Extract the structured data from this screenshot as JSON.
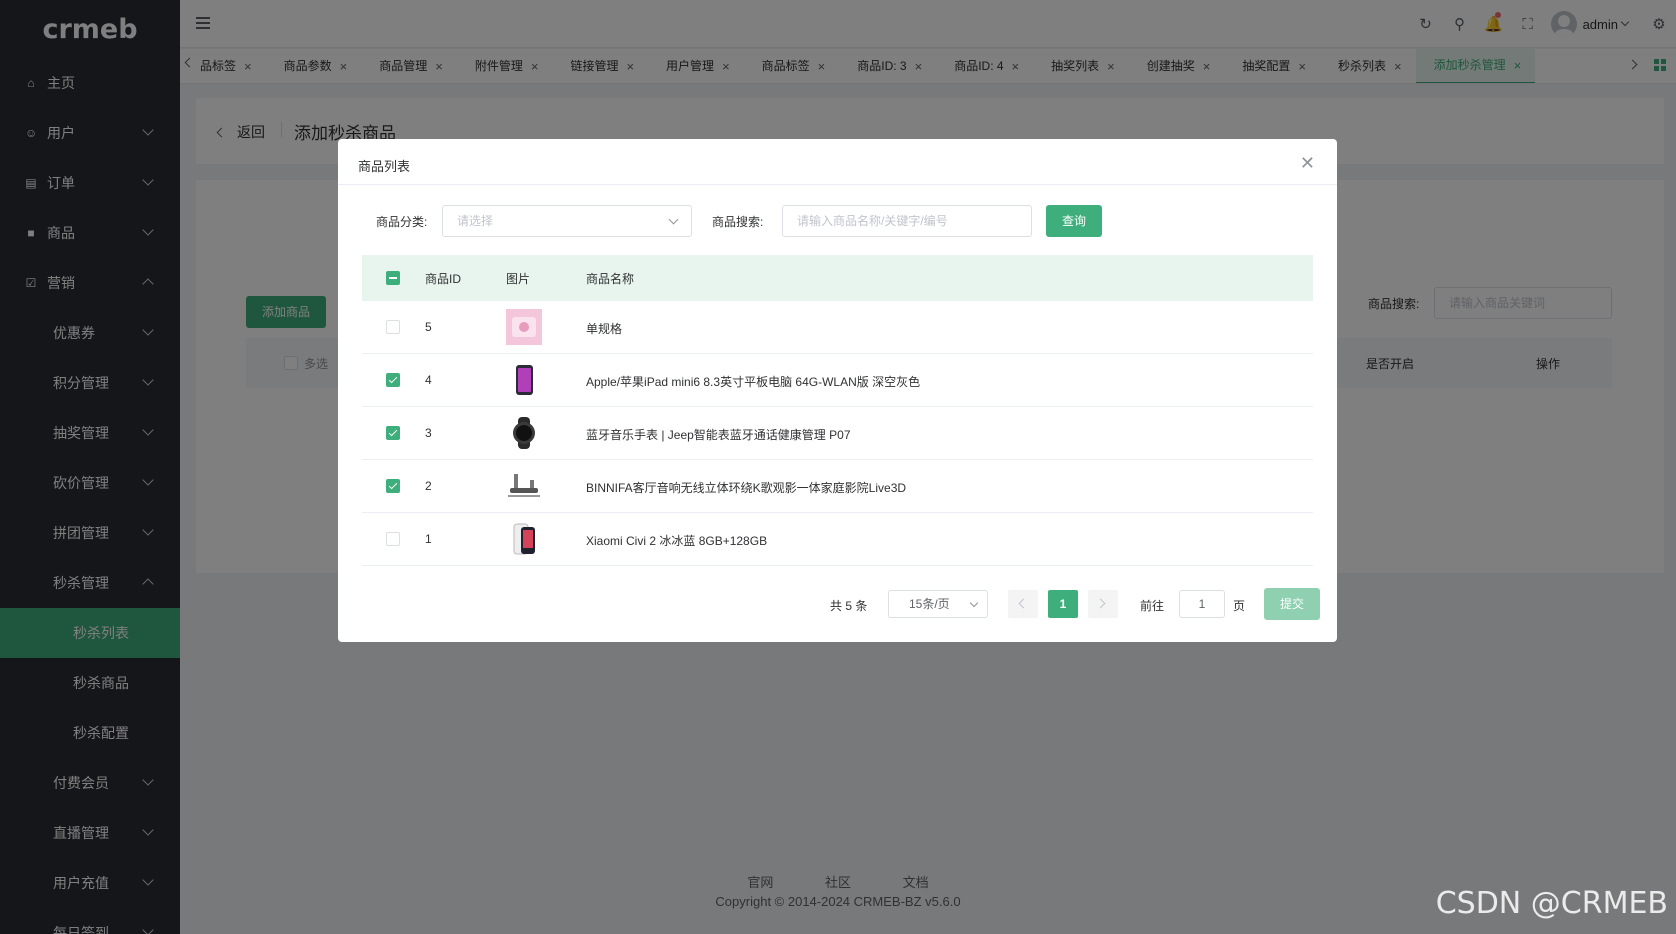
{
  "logo": "crmeb",
  "sidebar": {
    "items": [
      {
        "label": "主页",
        "icon": "home-icon",
        "level": 0,
        "arrow": "none"
      },
      {
        "label": "用户",
        "icon": "user-icon",
        "level": 0,
        "arrow": "down"
      },
      {
        "label": "订单",
        "icon": "order-icon",
        "level": 0,
        "arrow": "down"
      },
      {
        "label": "商品",
        "icon": "product-icon",
        "level": 0,
        "arrow": "down"
      },
      {
        "label": "营销",
        "icon": "marketing-icon",
        "level": 0,
        "arrow": "up"
      },
      {
        "label": "优惠券",
        "level": 1,
        "arrow": "down"
      },
      {
        "label": "积分管理",
        "level": 1,
        "arrow": "down"
      },
      {
        "label": "抽奖管理",
        "level": 1,
        "arrow": "down"
      },
      {
        "label": "砍价管理",
        "level": 1,
        "arrow": "down"
      },
      {
        "label": "拼团管理",
        "level": 1,
        "arrow": "down"
      },
      {
        "label": "秒杀管理",
        "level": 1,
        "arrow": "up"
      },
      {
        "label": "秒杀列表",
        "level": 2,
        "arrow": "none",
        "active": true
      },
      {
        "label": "秒杀商品",
        "level": 2,
        "arrow": "none"
      },
      {
        "label": "秒杀配置",
        "level": 2,
        "arrow": "none"
      },
      {
        "label": "付费会员",
        "level": 1,
        "arrow": "down"
      },
      {
        "label": "直播管理",
        "level": 1,
        "arrow": "down"
      },
      {
        "label": "用户充值",
        "level": 1,
        "arrow": "down"
      },
      {
        "label": "每日签到",
        "level": 1,
        "arrow": "down"
      }
    ]
  },
  "header": {
    "username": "admin",
    "icons": [
      "refresh-icon",
      "search-icon",
      "bell-icon",
      "fullscreen-icon",
      "settings-icon"
    ]
  },
  "tabs": [
    {
      "label": "品标签"
    },
    {
      "label": "商品参数"
    },
    {
      "label": "商品管理"
    },
    {
      "label": "附件管理"
    },
    {
      "label": "链接管理"
    },
    {
      "label": "用户管理"
    },
    {
      "label": "商品标签"
    },
    {
      "label": "商品ID: 3"
    },
    {
      "label": "商品ID: 4"
    },
    {
      "label": "抽奖列表"
    },
    {
      "label": "创建抽奖"
    },
    {
      "label": "抽奖配置"
    },
    {
      "label": "秒杀列表"
    },
    {
      "label": "添加秒杀管理",
      "active": true
    }
  ],
  "page": {
    "back_label": "返回",
    "title": "添加秒杀商品",
    "add_button": "添加商品",
    "search_label": "商品搜索:",
    "search_placeholder": "请输入商品关键词",
    "multi_label": "多选",
    "col_enabled": "是否开启",
    "col_action": "操作"
  },
  "modal": {
    "title": "商品列表",
    "category_label": "商品分类:",
    "category_placeholder": "请选择",
    "search_label": "商品搜索:",
    "search_placeholder": "请输入商品名称/关键字/编号",
    "query_button": "查询",
    "columns": {
      "id": "商品ID",
      "image": "图片",
      "name": "商品名称"
    },
    "rows": [
      {
        "id": "5",
        "name": "单规格",
        "checked": false,
        "thumb": "cosmetic-thumb"
      },
      {
        "id": "4",
        "name": "Apple/苹果iPad mini6 8.3英寸平板电脑 64G-WLAN版 深空灰色",
        "checked": true,
        "thumb": "ipad-thumb"
      },
      {
        "id": "3",
        "name": "蓝牙音乐手表 | Jeep智能表蓝牙通话健康管理 P07",
        "checked": true,
        "thumb": "watch-thumb"
      },
      {
        "id": "2",
        "name": "BINNIFA客厅音响无线立体环绕K歌观影一体家庭影院Live3D",
        "checked": true,
        "thumb": "speaker-thumb"
      },
      {
        "id": "1",
        "name": "Xiaomi Civi 2 冰冰蓝 8GB+128GB",
        "checked": false,
        "thumb": "phone-thumb"
      }
    ],
    "pagination": {
      "total": "共 5 条",
      "page_size": "15条/页",
      "current": "1",
      "goto_label": "前往",
      "goto_value": "1",
      "page_suffix": "页"
    },
    "submit_button": "提交"
  },
  "footer": {
    "links": [
      "官网",
      "社区",
      "文档"
    ],
    "copyright": "Copyright © 2014-2024 CRMEB-BZ v5.6.0"
  },
  "watermark": "CSDN @CRMEB",
  "colors": {
    "primary": "#3eaf7c",
    "sidebar_bg": "#282c34"
  }
}
